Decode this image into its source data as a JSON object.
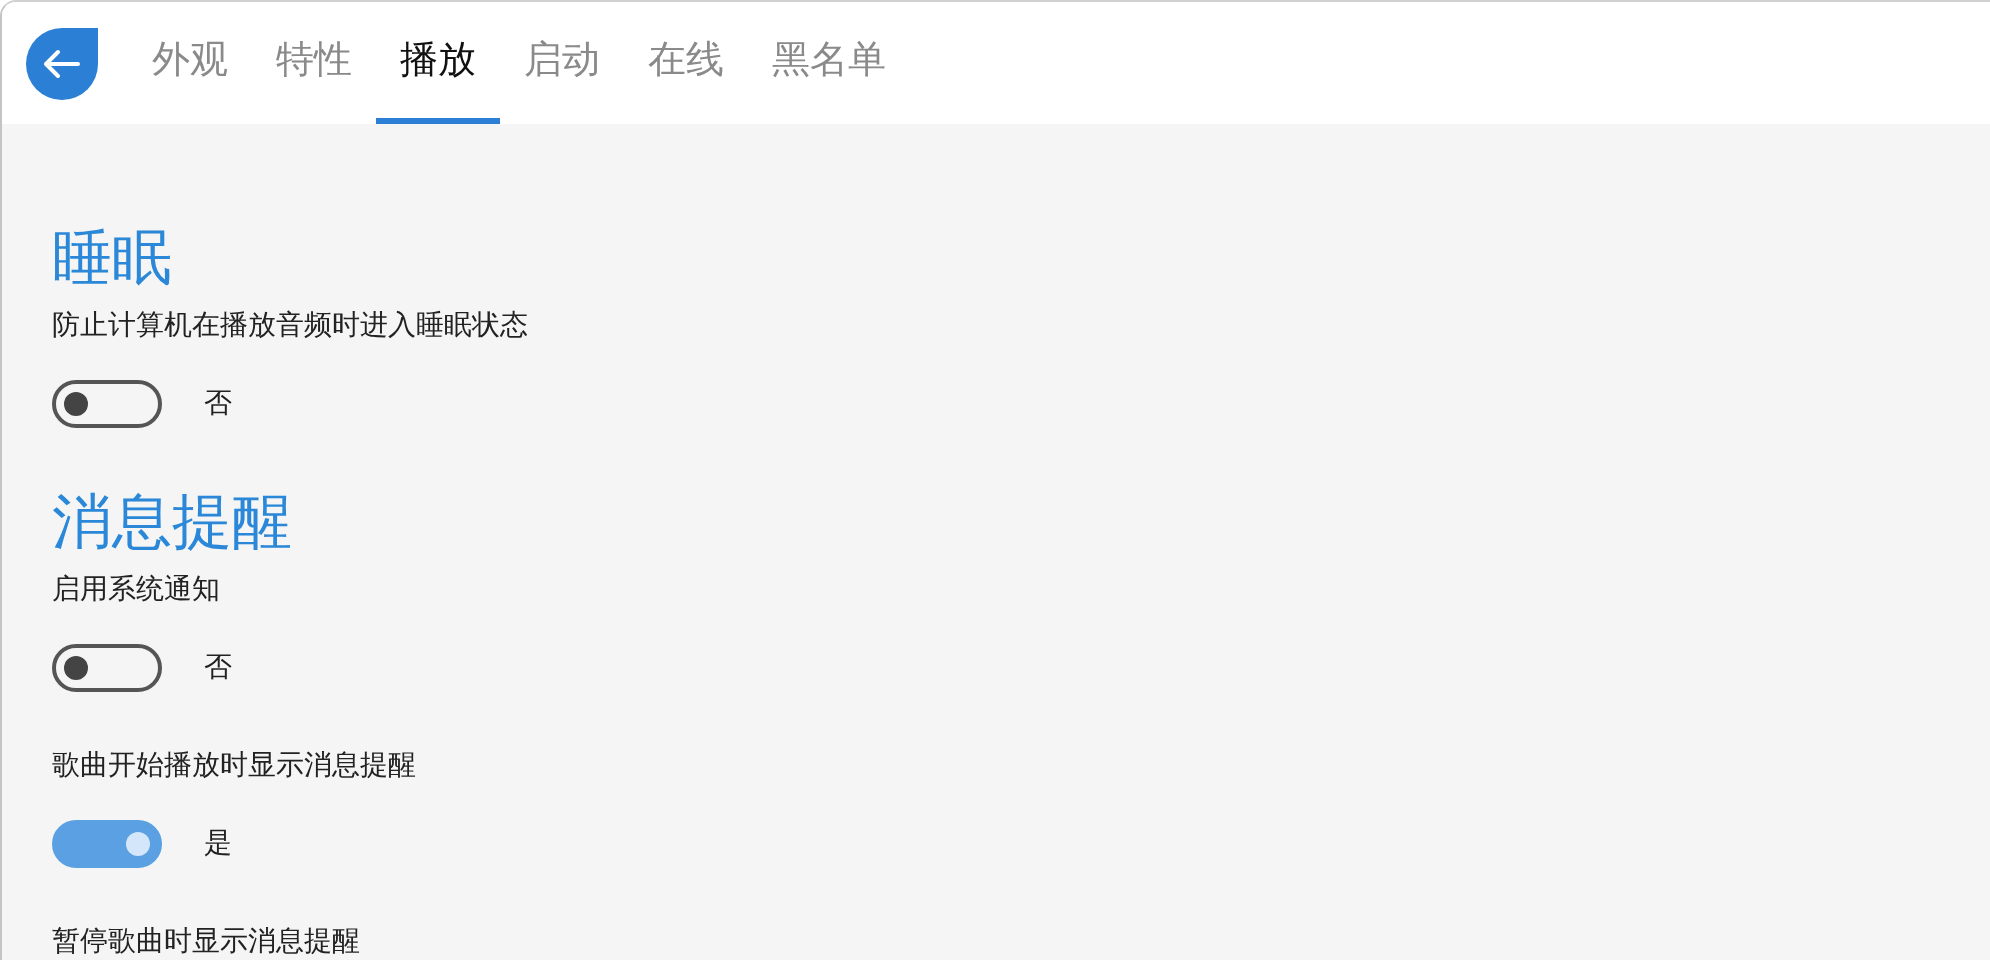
{
  "tabs": [
    {
      "label": "外观",
      "selected": false
    },
    {
      "label": "特性",
      "selected": false
    },
    {
      "label": "播放",
      "selected": true
    },
    {
      "label": "启动",
      "selected": false
    },
    {
      "label": "在线",
      "selected": false
    },
    {
      "label": "黑名单",
      "selected": false
    }
  ],
  "sections": [
    {
      "title": "睡眠",
      "settings": [
        {
          "label": "防止计算机在播放音频时进入睡眠状态",
          "on": false,
          "state_text": "否"
        }
      ]
    },
    {
      "title": "消息提醒",
      "settings": [
        {
          "label": "启用系统通知",
          "on": false,
          "state_text": "否"
        },
        {
          "label": "歌曲开始播放时显示消息提醒",
          "on": true,
          "state_text": "是"
        },
        {
          "label": "暂停歌曲时显示消息提醒"
        }
      ]
    }
  ]
}
